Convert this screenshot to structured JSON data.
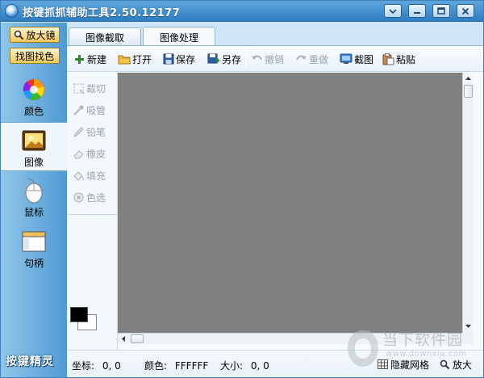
{
  "window": {
    "title": "按键抓抓辅助工具2.50.12177",
    "controls": [
      "menu-dropdown",
      "minimize",
      "maximize",
      "close"
    ]
  },
  "left_panel": {
    "zoom_button": "放大镜",
    "find_image_button": "找图找色",
    "nav": [
      {
        "label": "颜色",
        "icon": "color-wheel-icon",
        "active": false
      },
      {
        "label": "图像",
        "icon": "image-icon",
        "active": true
      },
      {
        "label": "鼠标",
        "icon": "mouse-icon",
        "active": false
      },
      {
        "label": "句柄",
        "icon": "window-icon",
        "active": false
      }
    ],
    "brand": "按键精灵"
  },
  "tabs": [
    {
      "label": "图像截取",
      "active": false
    },
    {
      "label": "图像处理",
      "active": true
    }
  ],
  "toolbar": {
    "new": "新建",
    "open": "打开",
    "save": "保存",
    "save_as": "另存",
    "undo": "撤销",
    "redo": "重做",
    "screenshot": "截图",
    "paste": "粘贴"
  },
  "tools": [
    {
      "label": "裁切",
      "icon": "crop-icon",
      "enabled": false
    },
    {
      "label": "吸管",
      "icon": "eyedropper-icon",
      "enabled": false
    },
    {
      "label": "铅笔",
      "icon": "pencil-icon",
      "enabled": false
    },
    {
      "label": "橡皮",
      "icon": "eraser-icon",
      "enabled": false
    },
    {
      "label": "填充",
      "icon": "fill-icon",
      "enabled": false
    },
    {
      "label": "色选",
      "icon": "color-select-icon",
      "enabled": false
    }
  ],
  "colors": {
    "foreground": "#000000",
    "background": "#FFFFFF",
    "canvas": "#808080"
  },
  "status": {
    "coords_label": "坐标:",
    "coords_value": "0, 0",
    "color_label": "颜色:",
    "color_value": "FFFFFF",
    "size_label": "大小:",
    "size_value": "0, 0",
    "hide_grid": "隐藏网格",
    "zoom": "放大"
  },
  "watermark": {
    "text": "当下软件园",
    "sub": "www.downxia.com"
  }
}
